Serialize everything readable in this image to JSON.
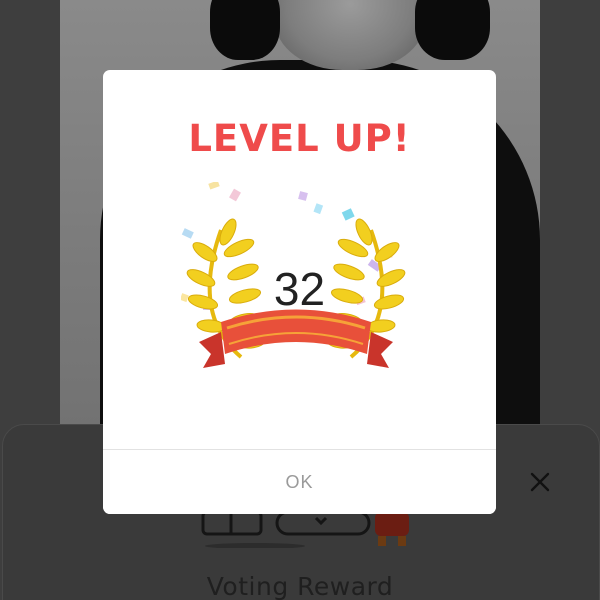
{
  "dialog": {
    "title": "LEVEL UP!",
    "level": "32",
    "ok_label": "OK"
  },
  "sheet": {
    "title": "Voting Reward",
    "close_icon": "close-icon"
  },
  "colors": {
    "title_red": "#ef4b4b",
    "laurel_yellow": "#f2cf1f",
    "ribbon_red": "#e8503a",
    "overlay_gray": "#3e3e3e"
  },
  "icons": {
    "laurel": "laurel-wreath-icon",
    "ribbon": "ribbon-banner-icon",
    "confetti": "confetti-icon"
  }
}
